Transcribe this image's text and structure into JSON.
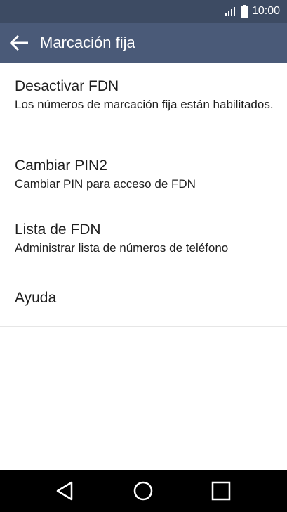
{
  "status_bar": {
    "time": "10:00",
    "icons": [
      "signal-icon",
      "battery-icon"
    ]
  },
  "app_bar": {
    "title": "Marcación fija",
    "back_icon": "arrow-left-icon"
  },
  "settings": [
    {
      "title": "Desactivar FDN",
      "subtitle": "Los números de marcación fija están habilitados."
    },
    {
      "title": "Cambiar PIN2",
      "subtitle": "Cambiar PIN para acceso de FDN"
    },
    {
      "title": "Lista de FDN",
      "subtitle": "Administrar lista de números de teléfono"
    },
    {
      "title": "Ayuda"
    }
  ],
  "nav_bar": {
    "buttons": [
      "back-triangle-icon",
      "home-circle-icon",
      "recents-square-icon"
    ]
  },
  "colors": {
    "status_bar": "#3d4b63",
    "app_bar": "#4a5a78",
    "nav_bar": "#000000",
    "text": "#1e1e1e",
    "divider": "#e6e6e6"
  }
}
